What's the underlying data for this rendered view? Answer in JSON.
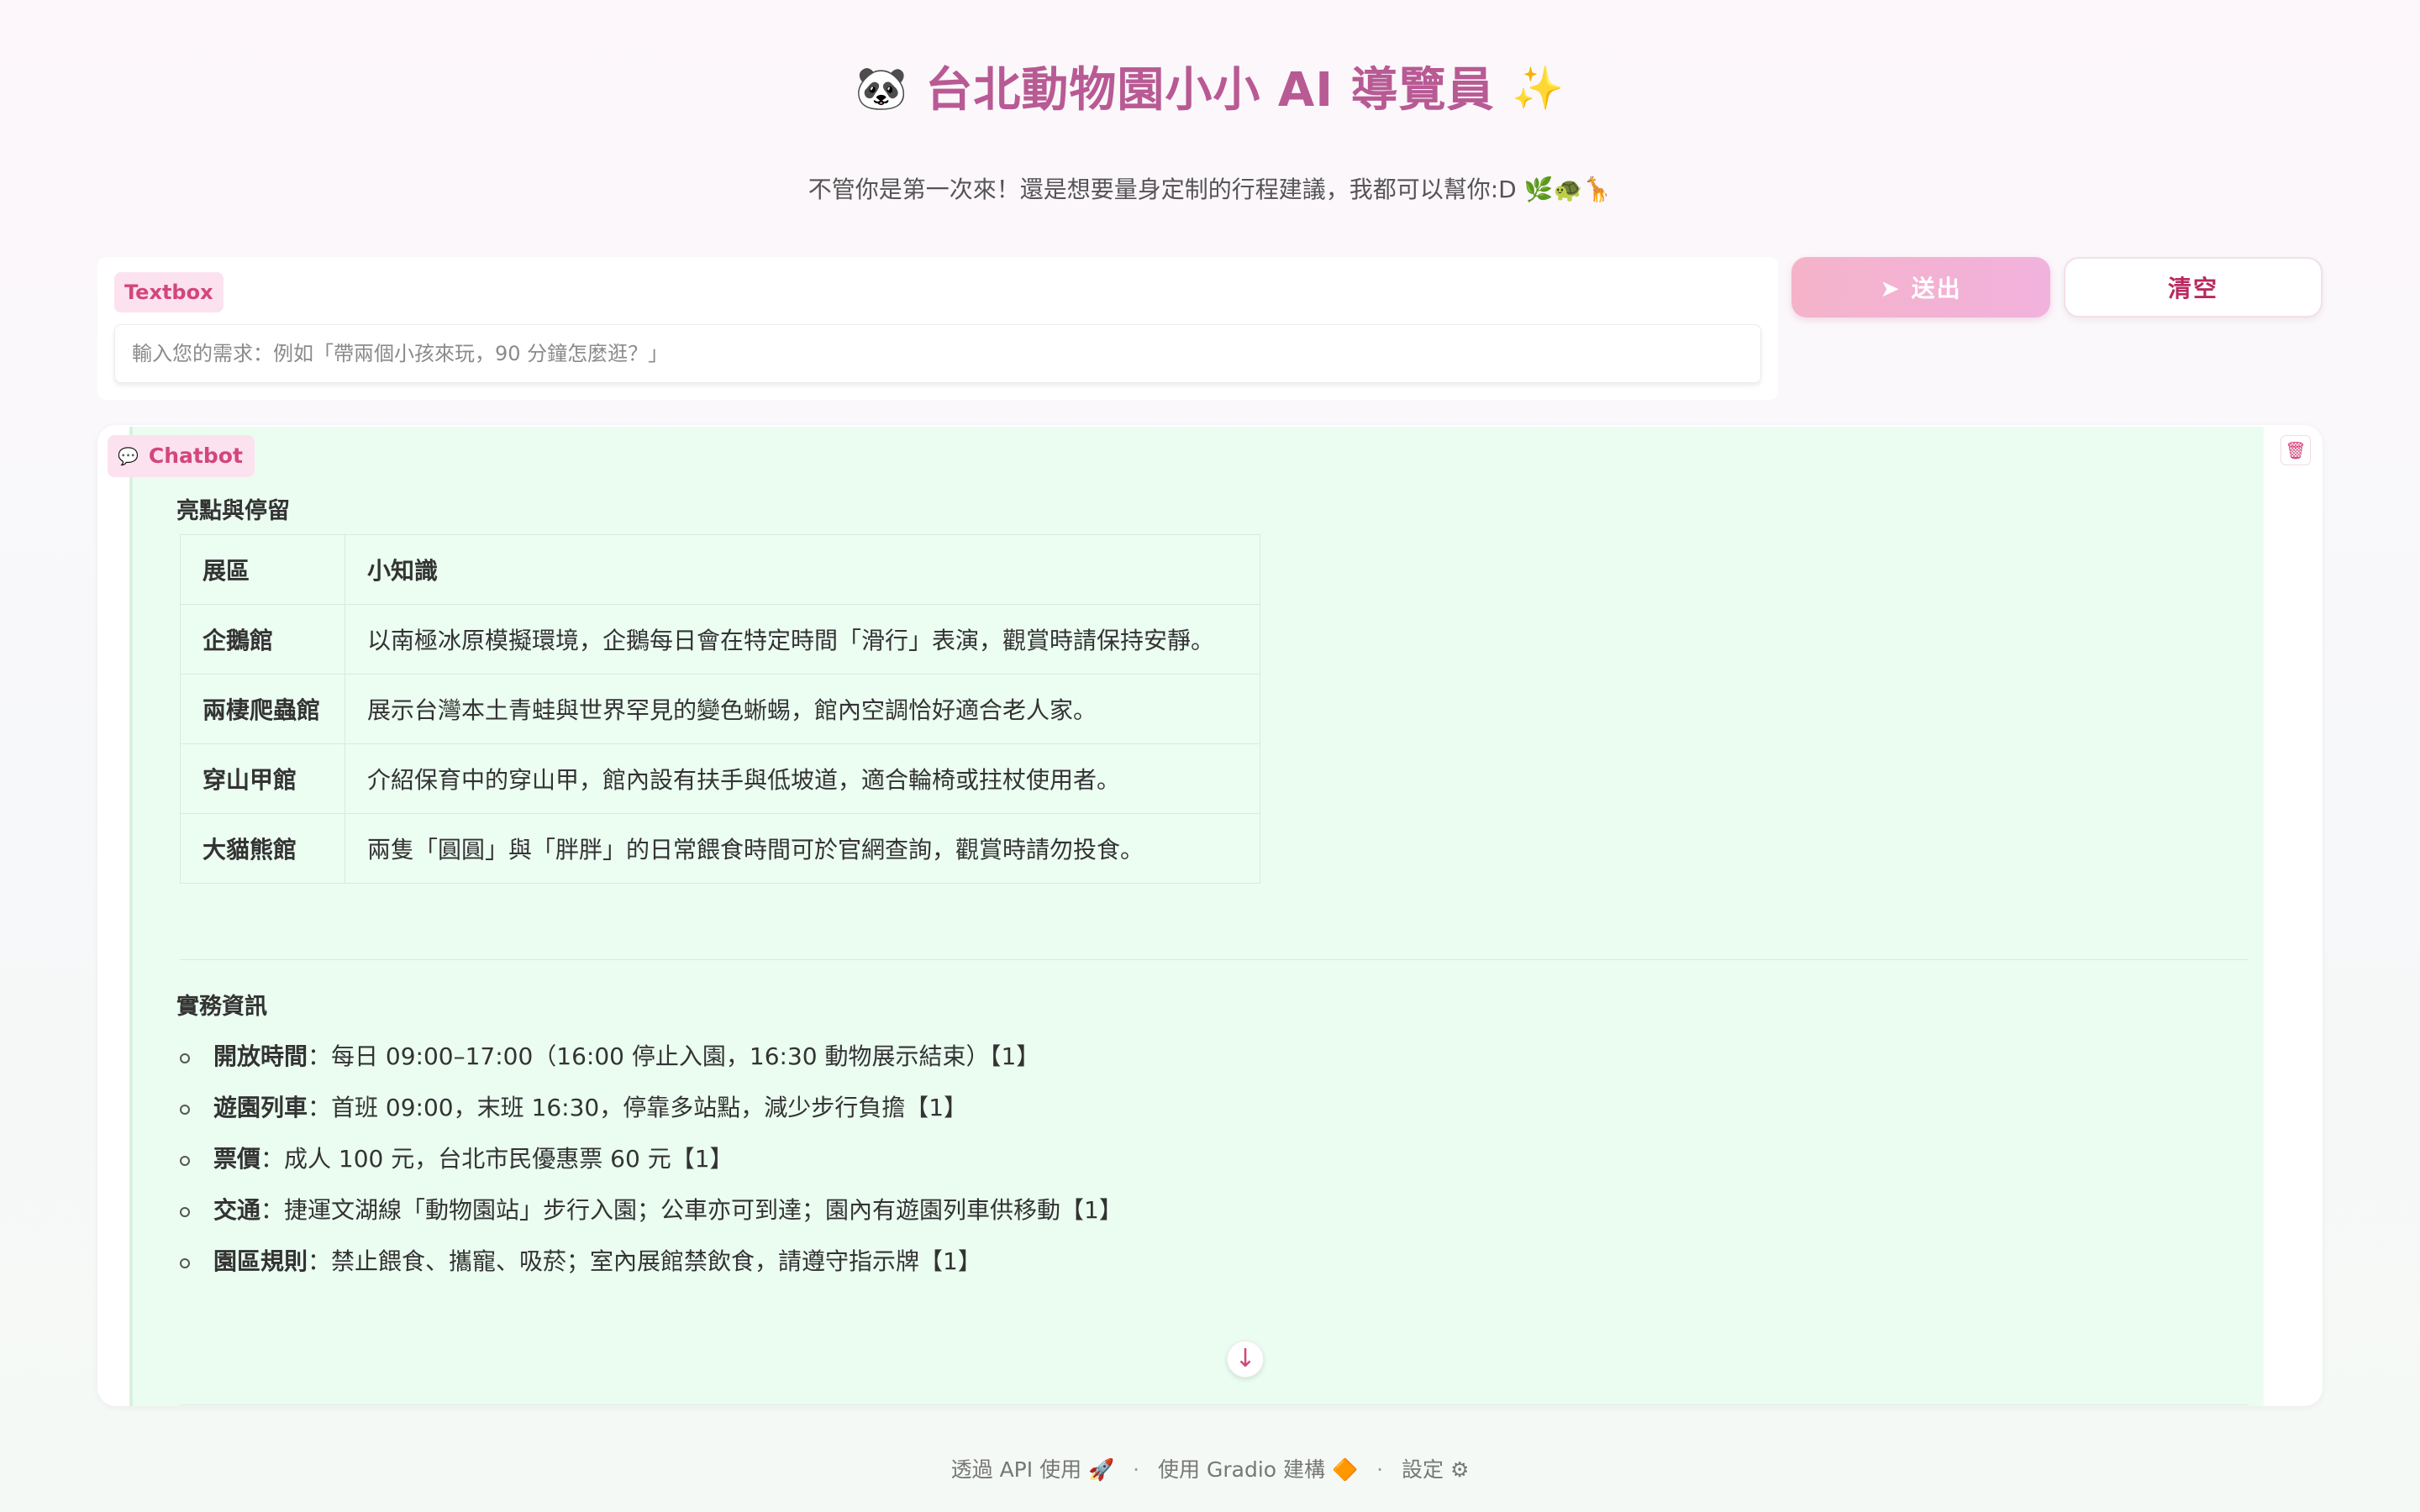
{
  "header": {
    "title_emoji": "🐼",
    "title": "台北動物園小小 AI 導覽員",
    "title_sparkle": "✨",
    "subtitle": "不管你是第一次來！還是想要量身定制的行程建議，我都可以幫你:D 🌿🐢🦒"
  },
  "input": {
    "label": "Textbox",
    "placeholder": "輸入您的需求：例如「帶兩個小孩來玩，90 分鐘怎麼逛？」",
    "value": ""
  },
  "buttons": {
    "send_label": "➤ 送出",
    "clear_label": "清空"
  },
  "chatbot": {
    "label": "Chatbot",
    "label_icon": "💬",
    "trash_icon": "🗑",
    "scroll_icon": "↓",
    "highlights_heading": "亮點與停留",
    "table_headers": [
      "展區",
      "小知識"
    ],
    "table_rows": [
      [
        "企鵝館",
        "以南極冰原模擬環境，企鵝每日會在特定時間「滑行」表演，觀賞時請保持安靜。"
      ],
      [
        "兩棲爬蟲館",
        "展示台灣本土青蛙與世界罕見的變色蜥蜴，館內空調恰好適合老人家。"
      ],
      [
        "穿山甲館",
        "介紹保育中的穿山甲，館內設有扶手與低坡道，適合輪椅或拄杖使用者。"
      ],
      [
        "大貓熊館",
        "兩隻「圓圓」與「胖胖」的日常餵食時間可於官網查詢，觀賞時請勿投食。"
      ]
    ],
    "practical_heading": "實務資訊",
    "practical_items": [
      {
        "key": "開放時間",
        "text": "：每日 09:00–17:00（16:00 停止入園，16:30 動物展示結束）【1】"
      },
      {
        "key": "遊園列車",
        "text": "：首班 09:00，末班 16:30，停靠多站點，減少步行負擔【1】"
      },
      {
        "key": "票價",
        "text": "：成人 100 元，台北市民優惠票 60 元【1】"
      },
      {
        "key": "交通",
        "text": "：捷運文湖線「動物園站」步行入園；公車亦可到達；園內有遊園列車供移動【1】"
      },
      {
        "key": "園區規則",
        "text": "：禁止餵食、攜寵、吸菸；室內展館禁飲食，請遵守指示牌【1】"
      }
    ]
  },
  "footer": {
    "api": "透過 API 使用",
    "api_icon": "🚀",
    "gradio": "使用 Gradio 建構",
    "gradio_icon": "🔶",
    "settings": "設定",
    "settings_icon": "⚙",
    "separator": "·"
  }
}
